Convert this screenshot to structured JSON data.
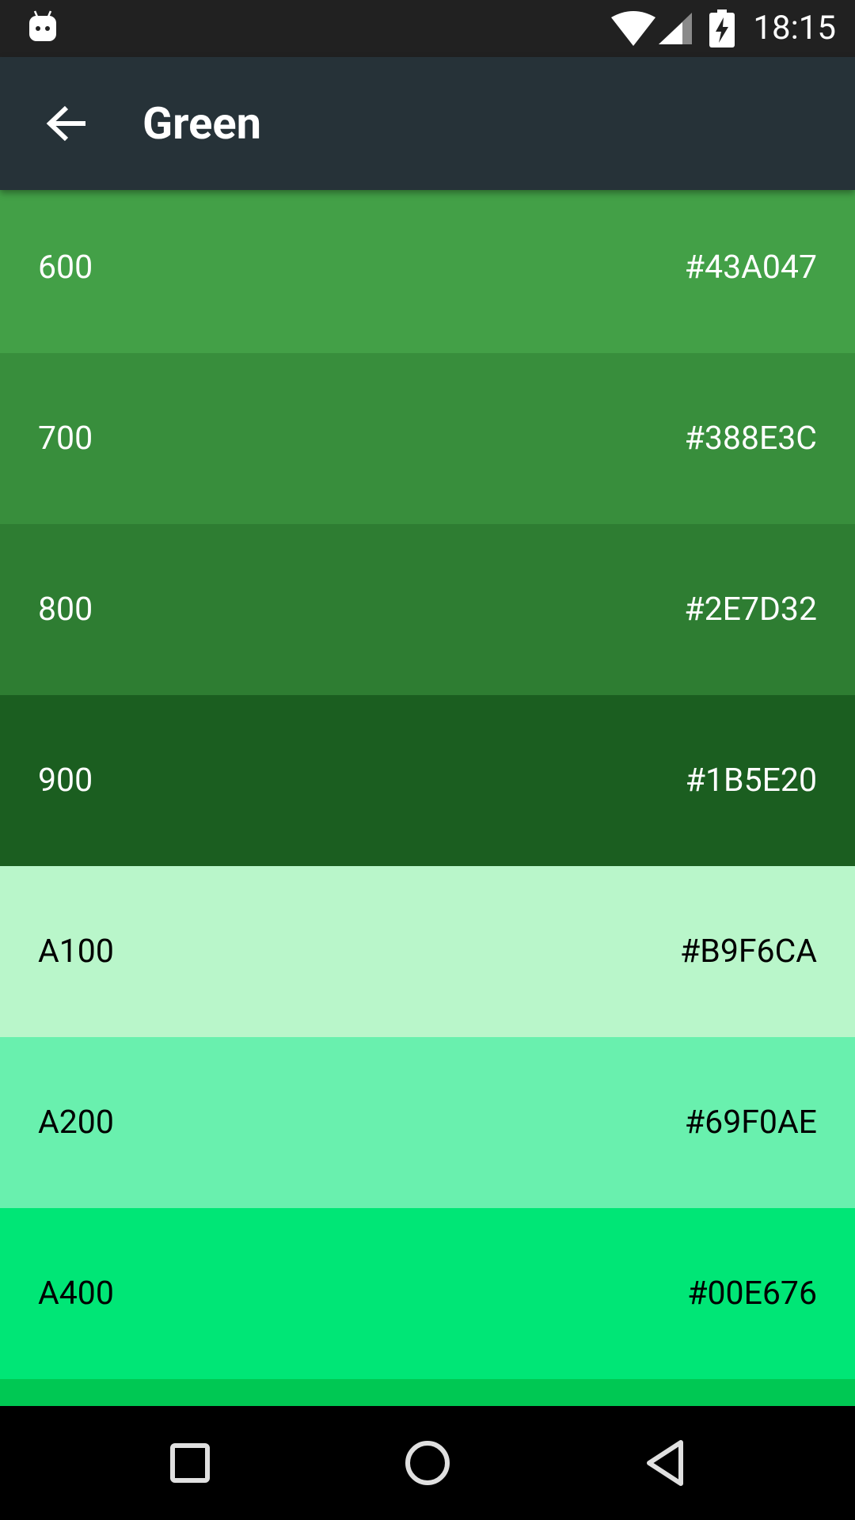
{
  "status_bar": {
    "time": "18:15",
    "icons": [
      "android-icon",
      "wifi-icon",
      "signal-icon",
      "battery-charging-icon"
    ]
  },
  "app_bar": {
    "title": "Green",
    "back_icon": "arrow-back-icon",
    "background": "#263238"
  },
  "swatches": [
    {
      "shade": "600",
      "hex": "#43A047",
      "color": "#43A047",
      "text_color": "#ffffff"
    },
    {
      "shade": "700",
      "hex": "#388E3C",
      "color": "#388E3C",
      "text_color": "#ffffff"
    },
    {
      "shade": "800",
      "hex": "#2E7D32",
      "color": "#2E7D32",
      "text_color": "#ffffff"
    },
    {
      "shade": "900",
      "hex": "#1B5E20",
      "color": "#1B5E20",
      "text_color": "#ffffff"
    },
    {
      "shade": "A100",
      "hex": "#B9F6CA",
      "color": "#B9F6CA",
      "text_color": "#000000"
    },
    {
      "shade": "A200",
      "hex": "#69F0AE",
      "color": "#69F0AE",
      "text_color": "#000000"
    },
    {
      "shade": "A400",
      "hex": "#00E676",
      "color": "#00E676",
      "text_color": "#000000"
    }
  ],
  "partial_swatch_color": "#00C853",
  "nav_bar": {
    "buttons": [
      "recents-icon",
      "home-icon",
      "back-icon"
    ]
  }
}
